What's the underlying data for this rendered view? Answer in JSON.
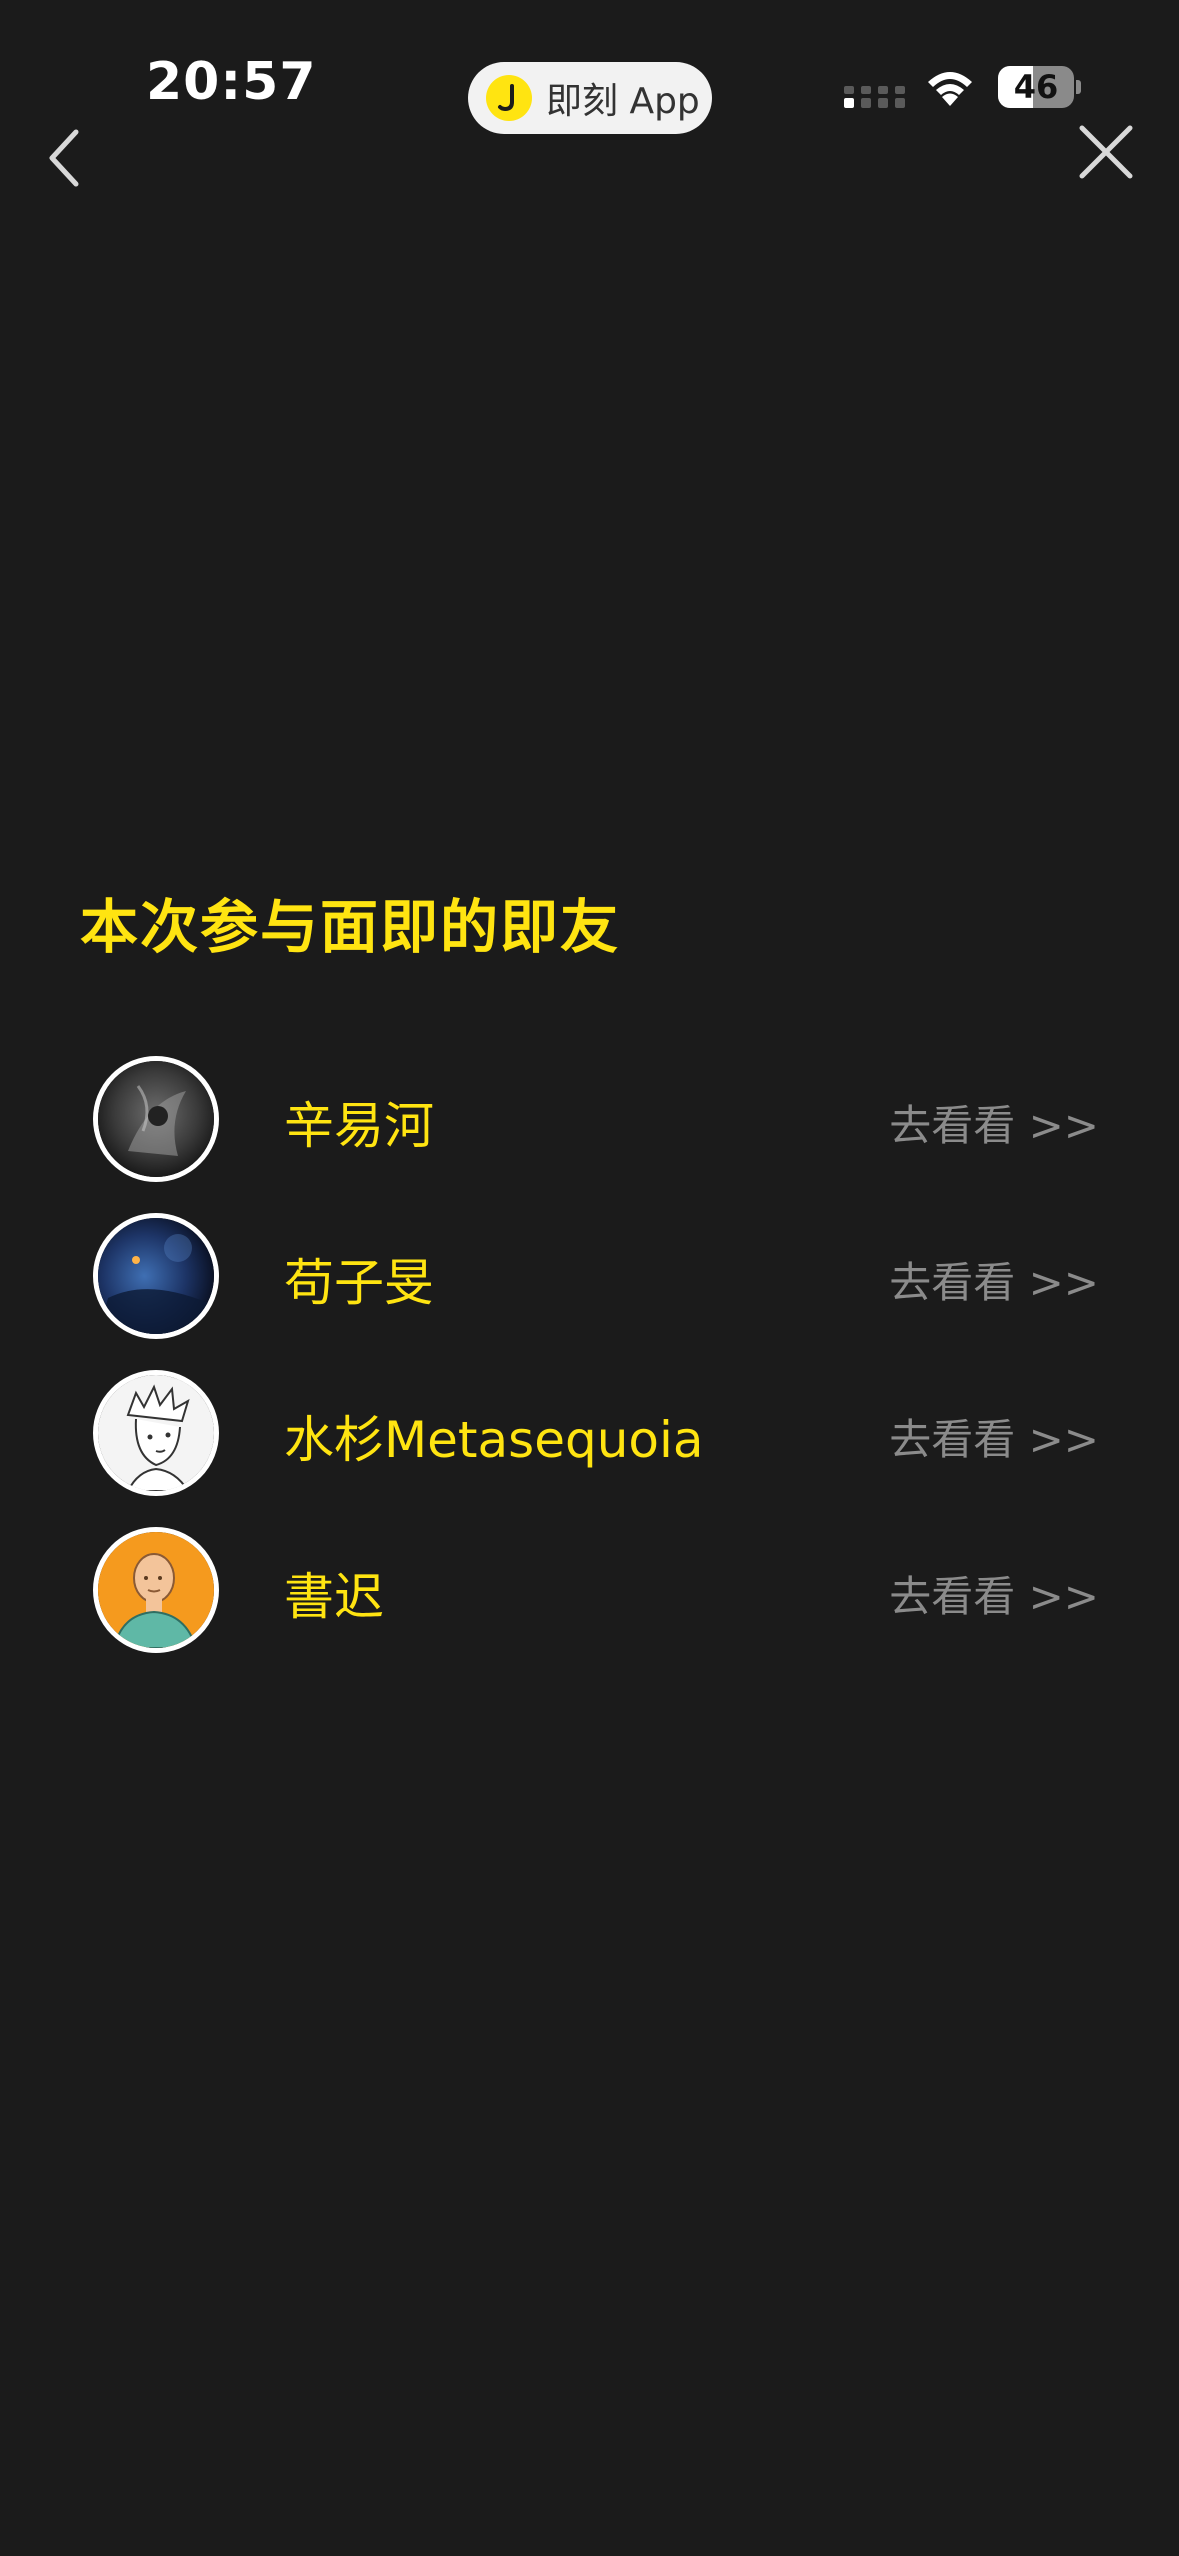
{
  "status_bar": {
    "time": "20:57",
    "app_name": "即刻 App",
    "battery": "46",
    "battery_level": 0.46
  },
  "nav": {
    "back_icon": "chevron-left-icon",
    "close_icon": "close-icon"
  },
  "section_title": "本次参与面即的即友",
  "friends": [
    {
      "name": "辛易河",
      "action": "去看看 >>"
    },
    {
      "name": "苟子旻",
      "action": "去看看 >>"
    },
    {
      "name": "水杉Metasequoia",
      "action": "去看看 >>"
    },
    {
      "name": "書迟",
      "action": "去看看 >>"
    }
  ],
  "colors": {
    "background": "#1b1b1b",
    "accent": "#ffe411",
    "secondary_text": "#8b8b8b"
  }
}
